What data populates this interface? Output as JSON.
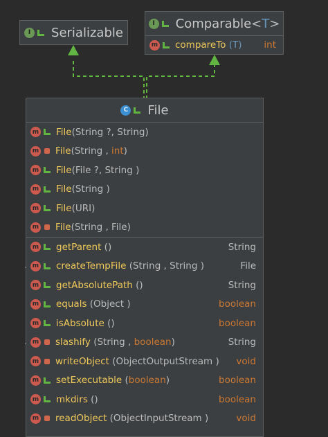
{
  "interfaces": [
    {
      "name": "Serializable",
      "kind": "I"
    },
    {
      "name": "Comparable",
      "kind": "I",
      "type_param": "T",
      "methods": [
        {
          "name": "compareTo",
          "params": "(T)",
          "returns": "int",
          "kind": "m"
        }
      ]
    }
  ],
  "main_class": {
    "name": "File",
    "kind": "C",
    "constructors": [
      {
        "name": "File",
        "params": "(String ?, String)",
        "visibility": "public"
      },
      {
        "name": "File",
        "params_pre": "(String , ",
        "params_kw": "int",
        "params_post": ")",
        "visibility": "private"
      },
      {
        "name": "File",
        "params": "(File ?, String )",
        "visibility": "public"
      },
      {
        "name": "File",
        "params": "(String )",
        "visibility": "public"
      },
      {
        "name": "File",
        "params": "(URI)",
        "visibility": "public"
      },
      {
        "name": "File",
        "params": "(String , File)",
        "visibility": "private"
      }
    ],
    "methods": [
      {
        "name": "getParent",
        "params": " ()",
        "returns": "String",
        "visibility": "public",
        "ret_kw": false
      },
      {
        "name": "createTempFile",
        "params": " (String , String )",
        "returns": "File",
        "visibility": "public",
        "ret_kw": false,
        "static": true
      },
      {
        "name": "getAbsolutePath",
        "params": " ()",
        "returns": "String",
        "visibility": "public",
        "ret_kw": false
      },
      {
        "name": "equals",
        "params": " (Object )",
        "returns": "boolean",
        "visibility": "public",
        "ret_kw": true
      },
      {
        "name": "isAbsolute",
        "params": " ()",
        "returns": "boolean",
        "visibility": "public",
        "ret_kw": true
      },
      {
        "name": "slashify",
        "params_pre": " (String , ",
        "params_kw": "boolean",
        "params_post": ")",
        "returns": "String",
        "visibility": "private",
        "ret_kw": false,
        "static": true
      },
      {
        "name": "writeObject",
        "params": " (ObjectOutputStream   )",
        "returns": "void",
        "visibility": "private",
        "ret_kw": true
      },
      {
        "name": "setExecutable",
        "params_pre": " (",
        "params_kw": "boolean",
        "params_post": ")",
        "returns": "boolean",
        "visibility": "public",
        "ret_kw": true
      },
      {
        "name": "mkdirs",
        "params": " ()",
        "returns": "boolean",
        "visibility": "public",
        "ret_kw": true
      },
      {
        "name": "readObject",
        "params": " (ObjectInputStream   )",
        "returns": "void",
        "visibility": "private",
        "ret_kw": true
      }
    ]
  },
  "icons": {
    "interface": "I",
    "class": "C",
    "method": "m"
  },
  "colors": {
    "background": "#2b2b2b",
    "node": "#3c3f41",
    "edge": "#62b543",
    "keyword": "#cc7832",
    "method_name": "#f0c95b"
  }
}
